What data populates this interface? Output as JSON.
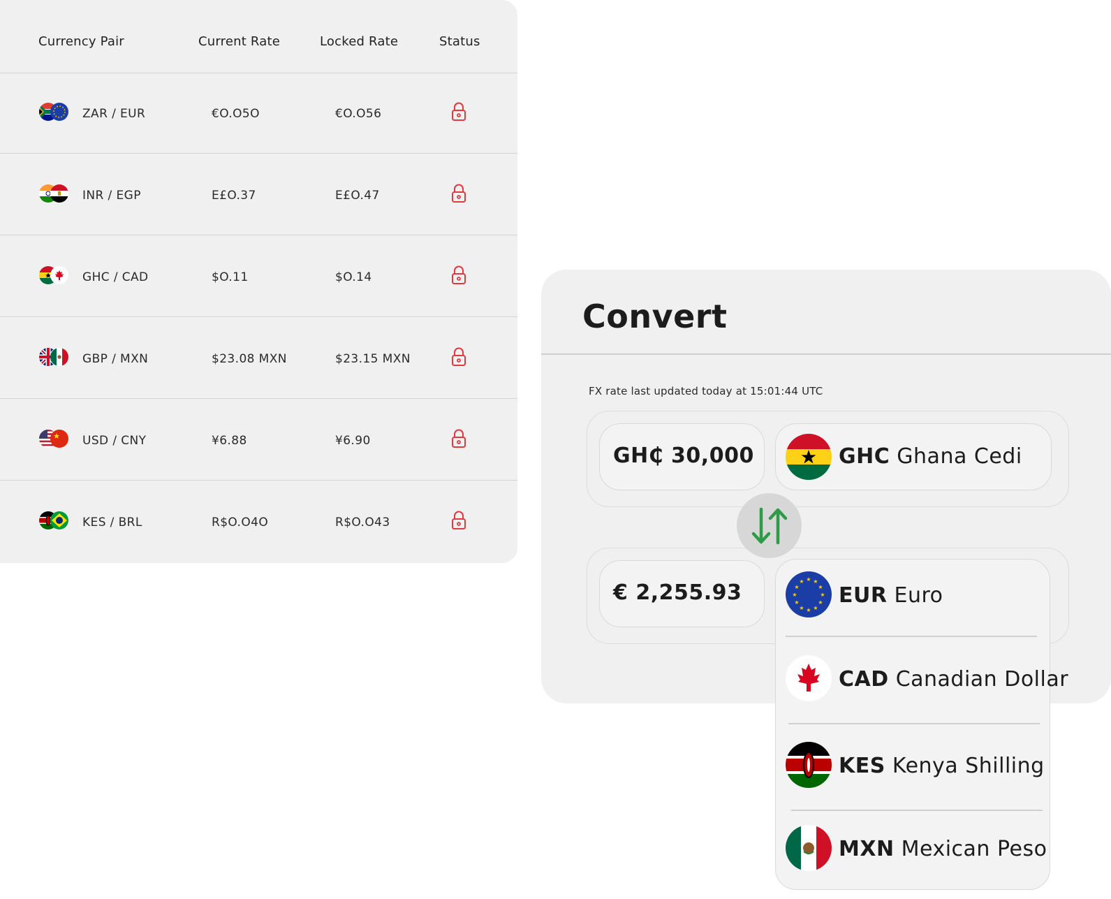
{
  "rates_table": {
    "headers": {
      "pair": "Currency Pair",
      "current": "Current Rate",
      "locked": "Locked Rate",
      "status": "Status"
    },
    "rows": [
      {
        "pair": "ZAR / EUR",
        "current": "€O.O5O",
        "locked": "€O.O56",
        "flags": [
          "south-africa-flag-icon",
          "eu-flag-icon"
        ],
        "status_icon": "lock-icon"
      },
      {
        "pair": "INR / EGP",
        "current": "E£O.37",
        "locked": "E£O.47",
        "flags": [
          "india-flag-icon",
          "egypt-flag-icon"
        ],
        "status_icon": "lock-icon"
      },
      {
        "pair": "GHC / CAD",
        "current": "$O.11",
        "locked": "$O.14",
        "flags": [
          "ghana-flag-icon",
          "canada-flag-icon"
        ],
        "status_icon": "lock-icon"
      },
      {
        "pair": "GBP / MXN",
        "current": "$23.08 MXN",
        "locked": "$23.15 MXN",
        "flags": [
          "uk-flag-icon",
          "mexico-flag-icon"
        ],
        "status_icon": "lock-icon"
      },
      {
        "pair": "USD / CNY",
        "current": "¥6.88",
        "locked": "¥6.90",
        "flags": [
          "usa-flag-icon",
          "china-flag-icon"
        ],
        "status_icon": "lock-icon"
      },
      {
        "pair": "KES / BRL",
        "current": "R$O.O4O",
        "locked": "R$O.O43",
        "flags": [
          "kenya-flag-icon",
          "brazil-flag-icon"
        ],
        "status_icon": "lock-icon"
      }
    ]
  },
  "convert": {
    "title": "Convert",
    "fx_note": "FX rate last updated today at 15:01:44 UTC",
    "from": {
      "amount": "GH₵ 30,000",
      "code": "GHC",
      "name": "Ghana Cedi",
      "flag": "ghana-flag-icon"
    },
    "to": {
      "amount": "€ 2,255.93",
      "code": "EUR",
      "name": "Euro",
      "flag": "eu-flag-icon"
    },
    "swap_icon": "swap-arrows-icon",
    "dropdown_options": [
      {
        "code": "CAD",
        "name": "Canadian Dollar",
        "flag": "canada-flag-icon"
      },
      {
        "code": "KES",
        "name": "Kenya Shilling",
        "flag": "kenya-flag-icon"
      },
      {
        "code": "MXN",
        "name": "Mexican Peso",
        "flag": "mexico-flag-icon"
      }
    ]
  },
  "colors": {
    "card_bg": "#f0f0f0",
    "lock_red": "#e0393e",
    "swap_green": "#2e9b48"
  }
}
